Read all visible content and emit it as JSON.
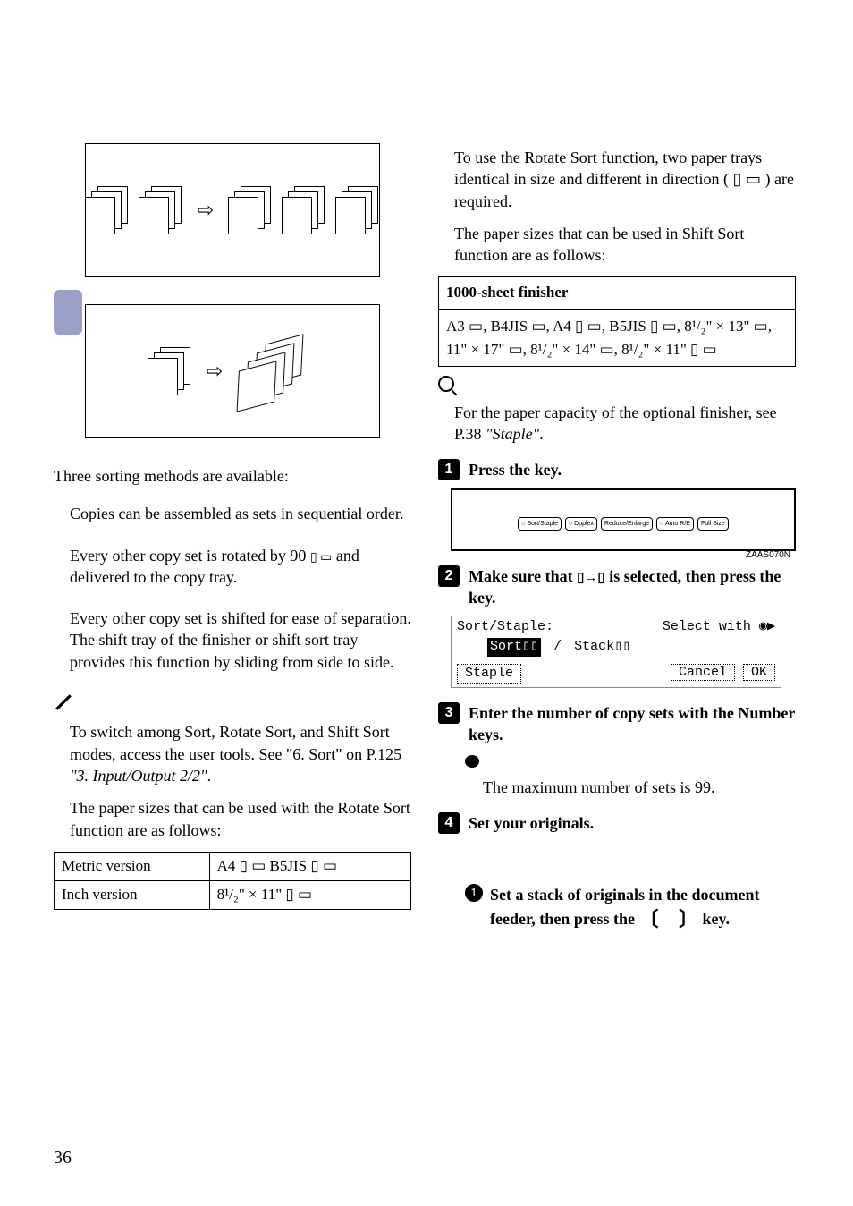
{
  "left": {
    "intro": "Three sorting methods are available:",
    "m1": "Copies can be assembled as sets in sequential order.",
    "m2a": "Every other copy set is rotated by 90 ",
    "m2b": " and delivered to the copy tray.",
    "m3": "Every other copy set is shifted for ease of separation. The shift tray of the finisher or shift sort tray provides this function by sliding from side to side.",
    "note1a": "To switch among Sort, Rotate Sort, and Shift Sort modes, access the user tools. See \"6. Sort\" on ",
    "note1b": "P.125 ",
    "note1c": "\"3. Input/Output 2/2\"",
    "note1d": ".",
    "note2": "The paper sizes that can be used with the Rotate Sort function are as follows:",
    "table": {
      "r1c1": "Metric version",
      "r1c2": "A4 ▯ ▭ B5JIS ▯ ▭",
      "r2c1": "Inch version",
      "r2c2": "8¹/₂\" × 11\" ▯ ▭"
    }
  },
  "right": {
    "para1": "To use the Rotate Sort function, two paper trays identical in size and different in direction ( ▯  ▭ ) are required.",
    "para2": "The paper sizes that can be used in Shift Sort function are as follows:",
    "box_hdr": "1000-sheet finisher",
    "box_body": "A3 ▭, B4JIS ▭, A4 ▯ ▭, B5JIS ▯ ▭, 8¹/₂\" × 13\" ▭, 11\" × 17\" ▭, 8¹/₂\" × 14\" ▭, 8¹/₂\" × 11\" ▯ ▭",
    "ref1": "For the paper capacity of the optional finisher, see ",
    "ref1b": "P.38 ",
    "ref1c": "\"Staple\"",
    "ref1d": ".",
    "step1": "Press the ",
    "step1b": " key.",
    "panel": {
      "b1": "○ Sort/Staple",
      "b2": "○  Duplex",
      "b3": "Reduce/Enlarge",
      "b4": "○  Auto R/E",
      "b5": "Full Size",
      "id": "ZAAS070N"
    },
    "step2a": "Make sure that ",
    "step2b": " is selected, then press the ",
    "step2c": " key.",
    "lcd": {
      "l1a": "Sort/Staple:",
      "l1b": "Select with ◉▶",
      "l2a": "Sort▯▯",
      "l2sep": "/",
      "l2b": "Stack▯▯",
      "staple": "Staple",
      "cancel": "Cancel",
      "ok": "OK"
    },
    "step3": "Enter the number of copy sets with the Number keys.",
    "step3note": "The maximum number of sets is 99.",
    "step4": "Set your originals.",
    "sub1a": "Set a stack of originals in the document feeder, then press the ",
    "sub1b": " key."
  },
  "page_num": "36"
}
